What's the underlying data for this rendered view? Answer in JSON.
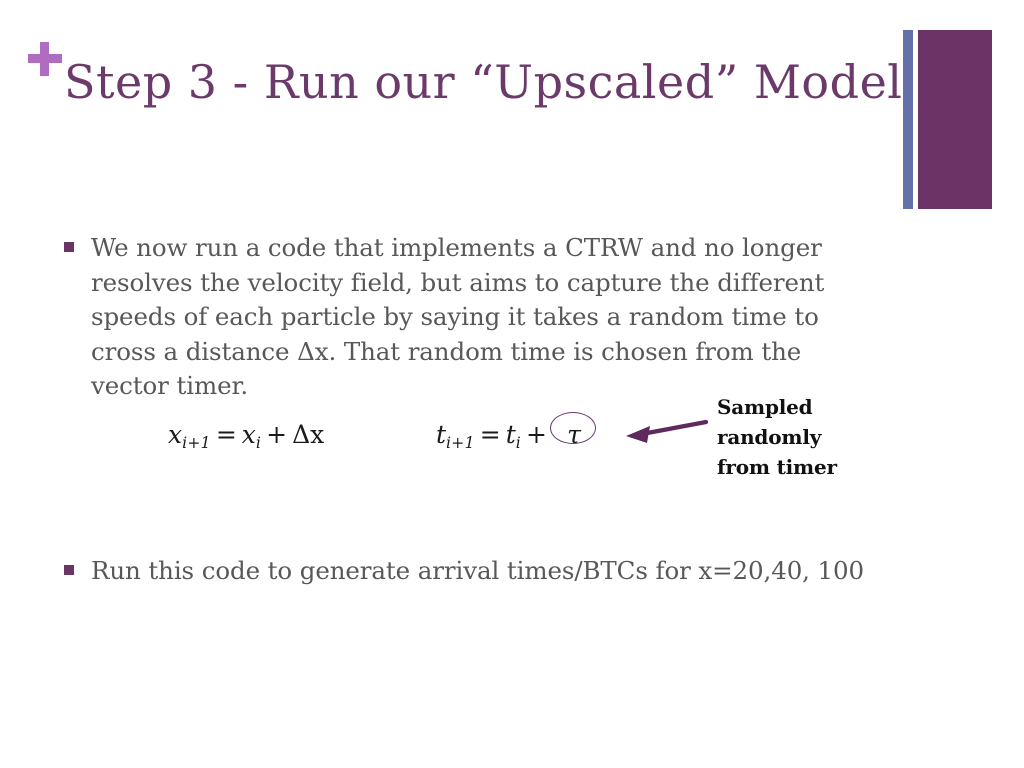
{
  "slide": {
    "title": "Step 3 -  Run our “Upscaled” Model",
    "plus_icon": "plus-icon",
    "accent_purple": "#6b3366",
    "accent_blue": "#6670a8",
    "title_color": "#6b3a6b",
    "body_color": "#58585a"
  },
  "bullets": [
    {
      "text": "We now run a code that implements a CTRW and no longer resolves the velocity field, but aims to capture the different speeds of each particle by saying it takes a random time to cross a distance Δx. That random time is chosen from the vector timer."
    },
    {
      "text": "Run this code to generate arrival times/BTCs for x=20,40, 100"
    }
  ],
  "equations": {
    "position": {
      "lhs_base": "x",
      "lhs_sub": "i+1",
      "equals": "=",
      "rhs_base": "x",
      "rhs_sub": "i",
      "plus": "+",
      "term": "Δx",
      "full": "x_{i+1} = x_i + Δx"
    },
    "time": {
      "lhs_base": "t",
      "lhs_sub": "i+1",
      "equals": "=",
      "rhs_base": "t",
      "rhs_sub": "i",
      "plus": "+",
      "term": "τ",
      "full": "t_{i+1} = t_i + τ"
    }
  },
  "annotation": {
    "line1": "Sampled",
    "line2": "randomly",
    "line3": "from timer",
    "arrow_color": "#5e2a5e",
    "highlight_color": "#6b3a6b"
  }
}
